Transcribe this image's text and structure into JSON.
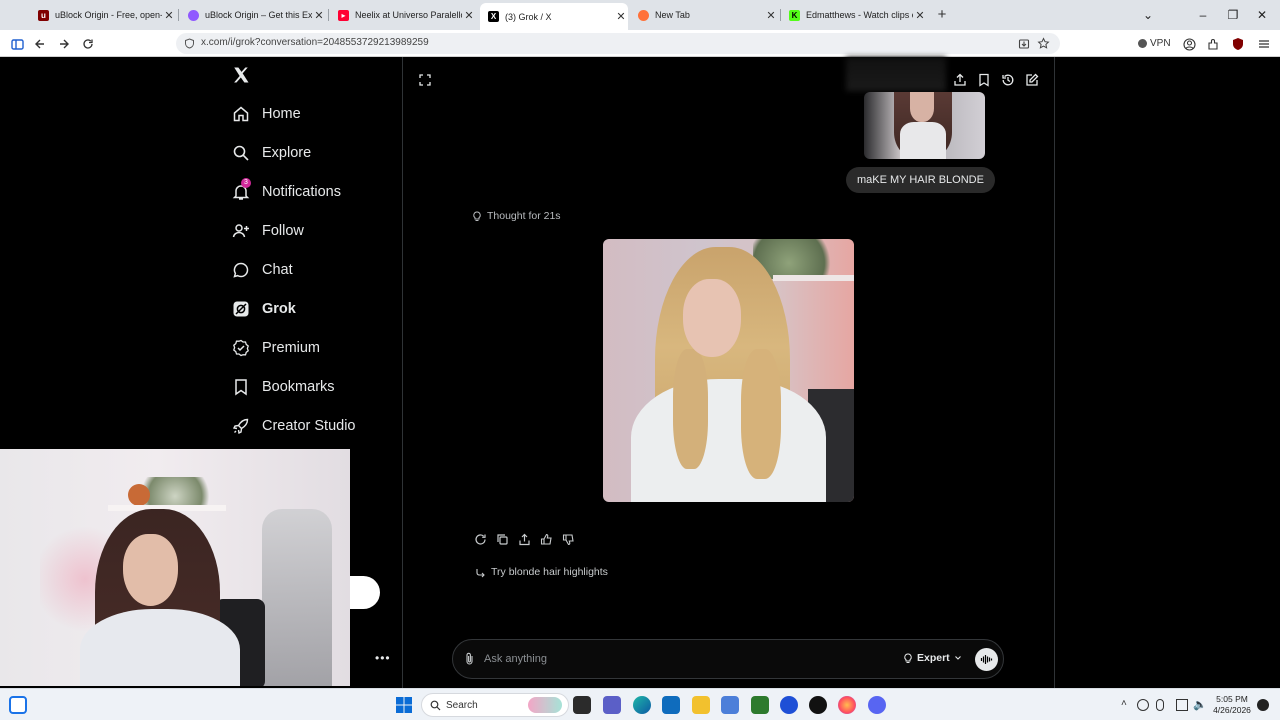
{
  "browser": {
    "tabs": [
      {
        "title": "uBlock Origin - Free, open-sour",
        "favicon": "ublock-icon",
        "color": "#800000"
      },
      {
        "title": "uBlock Origin – Get this Extensi",
        "favicon": "firefox-addon-icon",
        "color": "#9059ff"
      },
      {
        "title": "Neelix at Universo Paralello - Yo",
        "favicon": "youtube-icon",
        "color": "#ff0033"
      },
      {
        "title": "(3) Grok / X",
        "favicon": "x-icon",
        "color": "#000000"
      },
      {
        "title": "New Tab",
        "favicon": "firefox-icon",
        "color": "#ff7139"
      },
      {
        "title": "Edmatthews - Watch clips on Ki",
        "favicon": "kick-icon",
        "color": "#53fc18"
      }
    ],
    "active_tab_index": 3,
    "url": "x.com/i/grok?conversation=2048553729213989259",
    "vpn_label": "VPN"
  },
  "x_nav": {
    "items": [
      {
        "label": "Home",
        "icon": "home-icon"
      },
      {
        "label": "Explore",
        "icon": "search-icon"
      },
      {
        "label": "Notifications",
        "icon": "bell-icon",
        "badge": "3"
      },
      {
        "label": "Follow",
        "icon": "person-add-icon"
      },
      {
        "label": "Chat",
        "icon": "chat-bubble-icon"
      },
      {
        "label": "Grok",
        "icon": "grok-icon"
      },
      {
        "label": "Premium",
        "icon": "premium-check-icon"
      },
      {
        "label": "Bookmarks",
        "icon": "bookmark-icon"
      },
      {
        "label": "Creator Studio",
        "icon": "rocket-icon"
      }
    ],
    "active": "Grok"
  },
  "grok": {
    "user_message": "maKE MY HAIR BLONDE",
    "thought_label": "Thought for 21s",
    "suggestion": "Try blonde hair highlights",
    "composer_placeholder": "Ask anything",
    "mode_label": "Expert"
  },
  "taskbar": {
    "search_label": "Search",
    "time": "5:05 PM",
    "date": "4/26/2026"
  }
}
